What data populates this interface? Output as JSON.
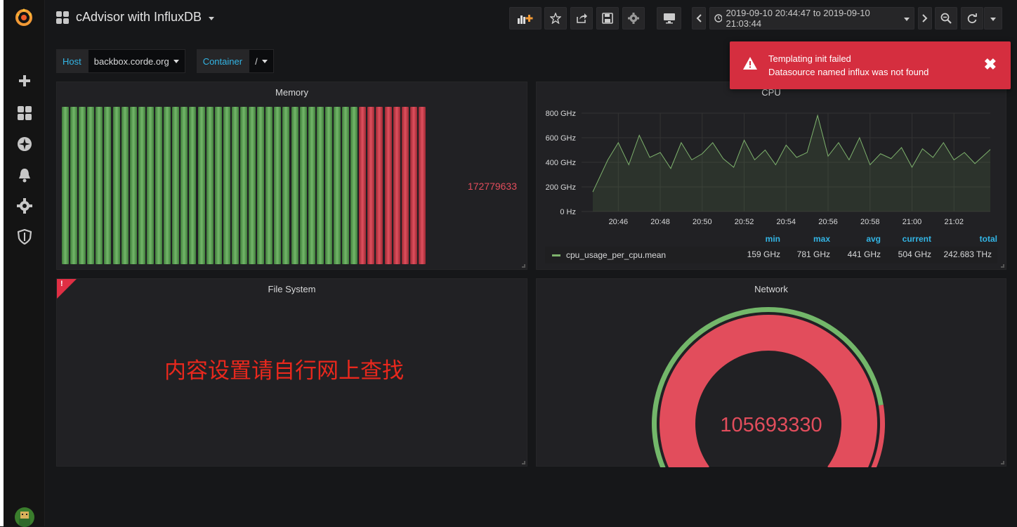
{
  "dashboard": {
    "title": "cAdvisor with InfluxDB"
  },
  "time_range": {
    "label": "2019-09-10 20:44:47 to 2019-09-10 21:03:44"
  },
  "variables": [
    {
      "label": "Host",
      "value": "backbox.corde.org"
    },
    {
      "label": "Container",
      "value": "/"
    }
  ],
  "panels": {
    "memory": {
      "title": "Memory",
      "value": "172779633",
      "bars_green": 35,
      "bars_red": 8
    },
    "cpu": {
      "title": "CPU",
      "legend_headers": {
        "min": "min",
        "max": "max",
        "avg": "avg",
        "current": "current",
        "total": "total"
      },
      "legend_row": {
        "name": "cpu_usage_per_cpu.mean",
        "min": "159 GHz",
        "max": "781 GHz",
        "avg": "441 GHz",
        "current": "504 GHz",
        "total": "242.683 THz",
        "color": "#7eb26d"
      }
    },
    "filesystem": {
      "title": "File System",
      "overlay_text": "内容设置请自行网上查找"
    },
    "network": {
      "title": "Network",
      "value": "105693330",
      "threshold_fraction": 0.82
    }
  },
  "toast": {
    "title": "Templating init failed",
    "message": "Datasource named influx was not found"
  },
  "colors": {
    "ok": "#73b76a",
    "critical": "#e24d5c",
    "accent": "#33b5e5",
    "error": "#d52e3f"
  },
  "chart_data": {
    "type": "line",
    "title": "CPU",
    "yticks": [
      "800 GHz",
      "600 GHz",
      "400 GHz",
      "200 GHz",
      "0 Hz"
    ],
    "xticks": [
      "20:46",
      "20:48",
      "20:50",
      "20:52",
      "20:54",
      "20:56",
      "20:58",
      "21:00",
      "21:02"
    ],
    "ylim": [
      0,
      800
    ],
    "grid": true,
    "legend": "bottom",
    "series": [
      {
        "name": "cpu_usage_per_cpu.mean",
        "x": [
          "20:44:47",
          "20:45:30",
          "20:46:00",
          "20:46:30",
          "20:47:00",
          "20:47:30",
          "20:48:00",
          "20:48:30",
          "20:49:00",
          "20:49:30",
          "20:50:00",
          "20:50:30",
          "20:51:00",
          "20:51:30",
          "20:52:00",
          "20:52:30",
          "20:53:00",
          "20:53:30",
          "20:54:00",
          "20:54:30",
          "20:55:00",
          "20:55:30",
          "20:56:00",
          "20:56:30",
          "20:57:00",
          "20:57:30",
          "20:58:00",
          "20:58:30",
          "20:59:00",
          "20:59:30",
          "21:00:00",
          "21:00:30",
          "21:01:00",
          "21:01:30",
          "21:02:00",
          "21:02:30",
          "21:03:00",
          "21:03:44"
        ],
        "values": [
          159,
          420,
          560,
          380,
          620,
          440,
          480,
          350,
          560,
          420,
          470,
          560,
          430,
          360,
          580,
          420,
          500,
          380,
          540,
          440,
          480,
          781,
          450,
          560,
          420,
          600,
          380,
          470,
          430,
          520,
          360,
          510,
          440,
          560,
          420,
          480,
          390,
          504
        ]
      }
    ]
  }
}
